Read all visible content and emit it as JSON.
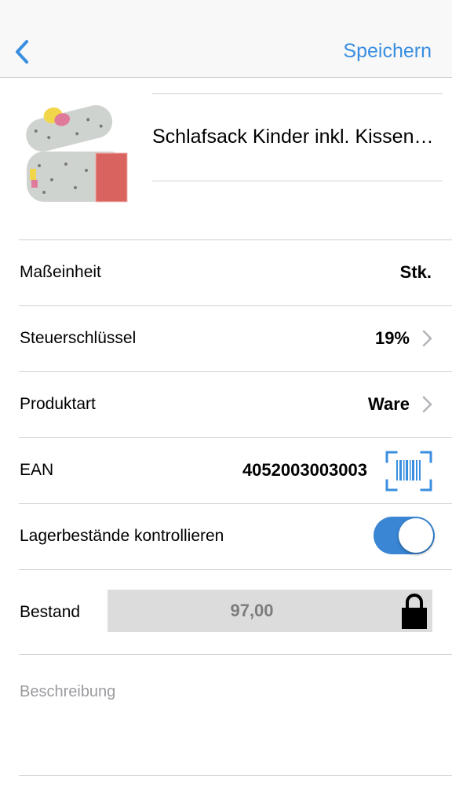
{
  "navbar": {
    "back_icon": "chevron-left-icon",
    "save_label": "Speichern",
    "accent_color": "#3a8ee0"
  },
  "product": {
    "title": "Schlafsack Kinder inkl. Kissen…"
  },
  "rows": {
    "unit": {
      "label": "Maßeinheit",
      "value": "Stk."
    },
    "tax": {
      "label": "Steuerschlüssel",
      "value": "19%"
    },
    "type": {
      "label": "Produktart",
      "value": "Ware"
    },
    "ean": {
      "label": "EAN",
      "value": "4052003003003",
      "icon": "barcode-scan-icon"
    },
    "stock_control": {
      "label": "Lagerbestände kontrollieren",
      "enabled": true,
      "toggle_color": "#3a86d4"
    },
    "stock": {
      "label": "Bestand",
      "value": "97,00",
      "icon": "lock-icon"
    }
  },
  "description": {
    "placeholder": "Beschreibung"
  }
}
